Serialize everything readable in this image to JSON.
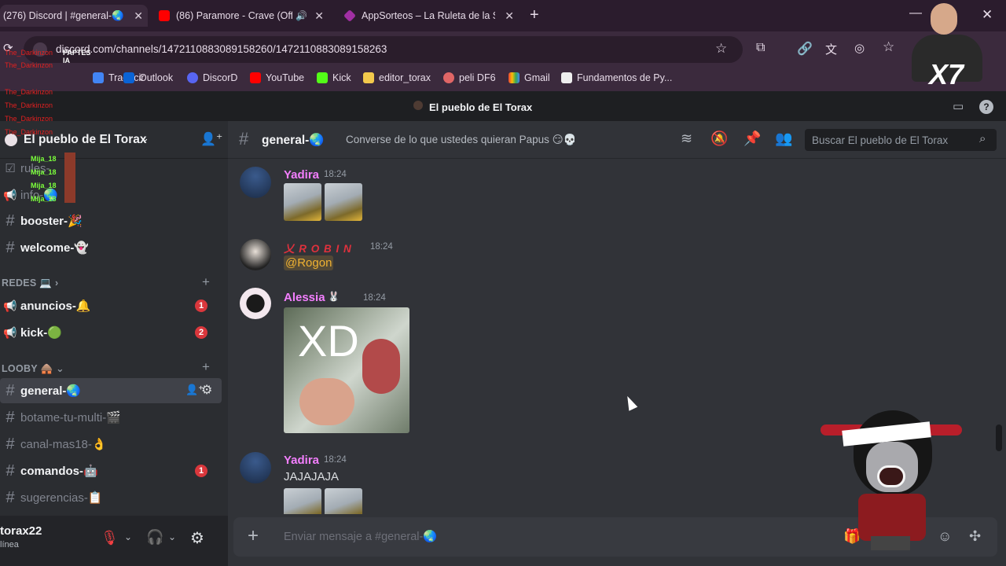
{
  "browser": {
    "tabs": [
      {
        "title": "(276) Discord | #general-🌏 | El p",
        "favicon_color": "#5865f2",
        "active": true
      },
      {
        "title": "(86) Paramore - Crave (Offic",
        "favicon_color": "#ff0000",
        "active": false
      },
      {
        "title": "AppSorteos – La Ruleta de la Su",
        "favicon_color": "#a12fa3",
        "active": false
      }
    ],
    "url": "discord.com/channels/1472110883089158260/1472110883089158263",
    "bookmarks": [
      "Traducir",
      "Outlook",
      "DiscorD",
      "YouTube",
      "Kick",
      "editor_torax",
      "peli DF6",
      "Gmail",
      "Fundamentos de Py..."
    ]
  },
  "overlay": {
    "title_label": "PAPTES IA",
    "darkinzon": "The_Darkinzon",
    "mija": "Mija_18",
    "streamer_badge": "X7"
  },
  "discord": {
    "server_title": "El pueblo de El Torax",
    "server_name": "El pueblo de El Torax",
    "channels_top": [
      {
        "name": "rules-",
        "type": "rules"
      },
      {
        "name": "info-🌏",
        "type": "announce"
      },
      {
        "name": "booster-🎉",
        "type": "text"
      },
      {
        "name": "welcome-👻",
        "type": "text"
      }
    ],
    "category_redes": "REDES 💻",
    "channels_redes": [
      {
        "name": "anuncios-🔔",
        "type": "announce",
        "badge": "1"
      },
      {
        "name": "kick-🟢",
        "type": "announce",
        "badge": "2"
      }
    ],
    "category_looby": "LOOBY 🛖",
    "channels_looby": [
      {
        "name": "general-🌏",
        "type": "text",
        "active": true
      },
      {
        "name": "botame-tu-multi-🎬",
        "type": "text",
        "muted": true
      },
      {
        "name": "canal-mas18-👌",
        "type": "thread",
        "muted": true
      },
      {
        "name": "comandos-🤖",
        "type": "text",
        "badge": "1"
      },
      {
        "name": "sugerencias-📋",
        "type": "text",
        "muted": true
      }
    ],
    "user": {
      "name": "torax22",
      "status": "línea"
    },
    "channel": {
      "name": "general-🌏",
      "topic": "Converse de lo que ustedes quieran Papus 😏💀"
    },
    "search_placeholder": "Buscar El pueblo de El Torax",
    "messages": [
      {
        "author": "Yadira",
        "time": "18:24",
        "color": "#f47fff",
        "text": ""
      },
      {
        "author": "乂 R O B I N",
        "time": "18:24",
        "color": "#e0313d",
        "text": "@Rogon"
      },
      {
        "author": "Alessia",
        "time": "18:24",
        "color": "#f47fff",
        "text": "",
        "image_caption": "XD"
      },
      {
        "author": "Yadira",
        "time": "18:24",
        "color": "#f47fff",
        "text": "JAJAJAJA"
      }
    ],
    "input_placeholder": "Enviar mensaje a #general-🌏"
  },
  "colors": {
    "accent": "#5865f2",
    "mention": "#f0b232",
    "badge": "#da373c"
  }
}
